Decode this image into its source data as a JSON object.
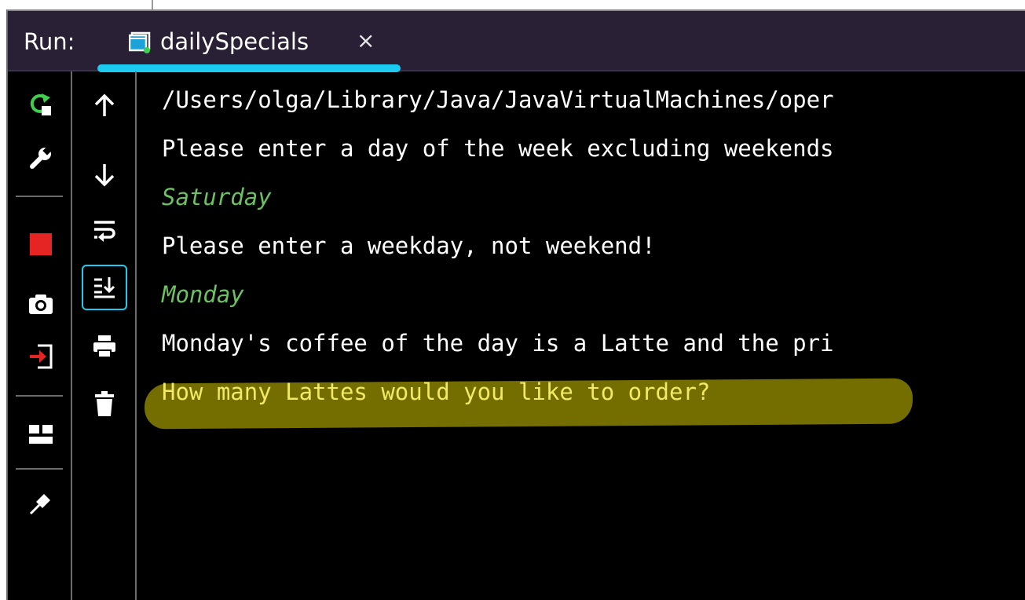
{
  "run_panel": {
    "label": "Run:",
    "tab": {
      "title": "dailySpecials",
      "close_glyph": "×",
      "icon": "console-window-icon"
    }
  },
  "left_toolbar": [
    {
      "name": "rerun-icon"
    },
    {
      "name": "wrench-icon"
    },
    {
      "name": "stop-icon"
    },
    {
      "name": "camera-icon"
    },
    {
      "name": "exit-icon"
    },
    {
      "name": "layout-icon"
    },
    {
      "name": "pin-icon"
    }
  ],
  "right_toolbar": [
    {
      "name": "arrow-up-icon"
    },
    {
      "name": "arrow-down-icon"
    },
    {
      "name": "soft-wrap-icon"
    },
    {
      "name": "scroll-to-end-icon",
      "active": true
    },
    {
      "name": "print-icon"
    },
    {
      "name": "trash-icon"
    }
  ],
  "colors": {
    "header_bg": "#2a2035",
    "tab_underline": "#1ecbf0",
    "console_bg": "#000000",
    "output_text": "#ffffff",
    "user_input": "#6cc160",
    "prompt_text": "#f2ea66",
    "highlight": "#7a7300",
    "stop_red": "#e52424",
    "rerun_green": "#3fcf4e",
    "exit_red": "#e52424"
  },
  "console": {
    "lines": [
      "/Users/olga/Library/Java/JavaVirtualMachines/oper",
      "Please enter a day of the week excluding weekends",
      "Saturday",
      "Please enter a weekday, not weekend!",
      "Monday",
      "Monday's coffee of the day is a Latte and the pri",
      "How many Lattes would you like to order?"
    ]
  }
}
